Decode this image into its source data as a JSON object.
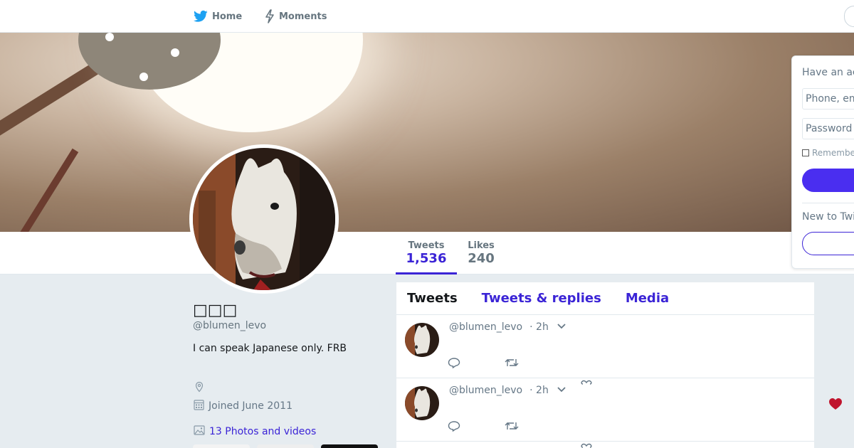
{
  "nav": {
    "home_label": "Home",
    "moments_label": "Moments",
    "home_icon": "twitter-bird-icon",
    "moments_icon": "lightning-icon"
  },
  "profile": {
    "name": "□□□",
    "handle": "@blumen_levo",
    "bio": "I can speak Japanese only. FRB",
    "joined": "Joined June 2011",
    "photos_link": "13 Photos and videos"
  },
  "stats": {
    "tweets_label": "Tweets",
    "tweets_value": "1,536",
    "likes_label": "Likes",
    "likes_value": "240"
  },
  "timeline": {
    "tabs": [
      "Tweets",
      "Tweets & replies",
      "Media"
    ],
    "active_tab": "Tweets",
    "tweets": [
      {
        "handle": "@blumen_levo",
        "time": "· 2h"
      },
      {
        "handle": "@blumen_levo",
        "time": "· 2h"
      }
    ]
  },
  "login": {
    "title": "Have an ac",
    "phone_placeholder": "Phone, em",
    "password_placeholder": "Password",
    "remember": "Remembe",
    "new_to": "New to Twi"
  },
  "colors": {
    "accent": "#3b24d6",
    "button": "#4a2ef0",
    "heart": "#c0142d",
    "twitter_blue": "#1da1f2"
  }
}
